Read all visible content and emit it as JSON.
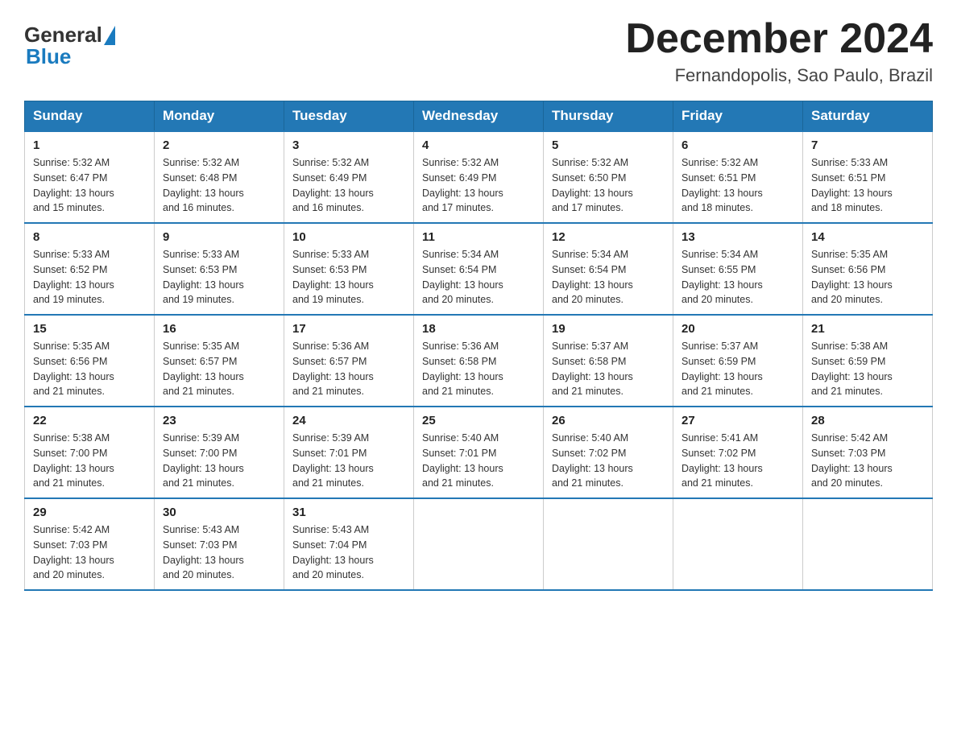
{
  "logo": {
    "general": "General",
    "blue": "Blue"
  },
  "title": "December 2024",
  "location": "Fernandopolis, Sao Paulo, Brazil",
  "days_of_week": [
    "Sunday",
    "Monday",
    "Tuesday",
    "Wednesday",
    "Thursday",
    "Friday",
    "Saturday"
  ],
  "weeks": [
    [
      {
        "day": "1",
        "sunrise": "5:32 AM",
        "sunset": "6:47 PM",
        "daylight": "13 hours and 15 minutes."
      },
      {
        "day": "2",
        "sunrise": "5:32 AM",
        "sunset": "6:48 PM",
        "daylight": "13 hours and 16 minutes."
      },
      {
        "day": "3",
        "sunrise": "5:32 AM",
        "sunset": "6:49 PM",
        "daylight": "13 hours and 16 minutes."
      },
      {
        "day": "4",
        "sunrise": "5:32 AM",
        "sunset": "6:49 PM",
        "daylight": "13 hours and 17 minutes."
      },
      {
        "day": "5",
        "sunrise": "5:32 AM",
        "sunset": "6:50 PM",
        "daylight": "13 hours and 17 minutes."
      },
      {
        "day": "6",
        "sunrise": "5:32 AM",
        "sunset": "6:51 PM",
        "daylight": "13 hours and 18 minutes."
      },
      {
        "day": "7",
        "sunrise": "5:33 AM",
        "sunset": "6:51 PM",
        "daylight": "13 hours and 18 minutes."
      }
    ],
    [
      {
        "day": "8",
        "sunrise": "5:33 AM",
        "sunset": "6:52 PM",
        "daylight": "13 hours and 19 minutes."
      },
      {
        "day": "9",
        "sunrise": "5:33 AM",
        "sunset": "6:53 PM",
        "daylight": "13 hours and 19 minutes."
      },
      {
        "day": "10",
        "sunrise": "5:33 AM",
        "sunset": "6:53 PM",
        "daylight": "13 hours and 19 minutes."
      },
      {
        "day": "11",
        "sunrise": "5:34 AM",
        "sunset": "6:54 PM",
        "daylight": "13 hours and 20 minutes."
      },
      {
        "day": "12",
        "sunrise": "5:34 AM",
        "sunset": "6:54 PM",
        "daylight": "13 hours and 20 minutes."
      },
      {
        "day": "13",
        "sunrise": "5:34 AM",
        "sunset": "6:55 PM",
        "daylight": "13 hours and 20 minutes."
      },
      {
        "day": "14",
        "sunrise": "5:35 AM",
        "sunset": "6:56 PM",
        "daylight": "13 hours and 20 minutes."
      }
    ],
    [
      {
        "day": "15",
        "sunrise": "5:35 AM",
        "sunset": "6:56 PM",
        "daylight": "13 hours and 21 minutes."
      },
      {
        "day": "16",
        "sunrise": "5:35 AM",
        "sunset": "6:57 PM",
        "daylight": "13 hours and 21 minutes."
      },
      {
        "day": "17",
        "sunrise": "5:36 AM",
        "sunset": "6:57 PM",
        "daylight": "13 hours and 21 minutes."
      },
      {
        "day": "18",
        "sunrise": "5:36 AM",
        "sunset": "6:58 PM",
        "daylight": "13 hours and 21 minutes."
      },
      {
        "day": "19",
        "sunrise": "5:37 AM",
        "sunset": "6:58 PM",
        "daylight": "13 hours and 21 minutes."
      },
      {
        "day": "20",
        "sunrise": "5:37 AM",
        "sunset": "6:59 PM",
        "daylight": "13 hours and 21 minutes."
      },
      {
        "day": "21",
        "sunrise": "5:38 AM",
        "sunset": "6:59 PM",
        "daylight": "13 hours and 21 minutes."
      }
    ],
    [
      {
        "day": "22",
        "sunrise": "5:38 AM",
        "sunset": "7:00 PM",
        "daylight": "13 hours and 21 minutes."
      },
      {
        "day": "23",
        "sunrise": "5:39 AM",
        "sunset": "7:00 PM",
        "daylight": "13 hours and 21 minutes."
      },
      {
        "day": "24",
        "sunrise": "5:39 AM",
        "sunset": "7:01 PM",
        "daylight": "13 hours and 21 minutes."
      },
      {
        "day": "25",
        "sunrise": "5:40 AM",
        "sunset": "7:01 PM",
        "daylight": "13 hours and 21 minutes."
      },
      {
        "day": "26",
        "sunrise": "5:40 AM",
        "sunset": "7:02 PM",
        "daylight": "13 hours and 21 minutes."
      },
      {
        "day": "27",
        "sunrise": "5:41 AM",
        "sunset": "7:02 PM",
        "daylight": "13 hours and 21 minutes."
      },
      {
        "day": "28",
        "sunrise": "5:42 AM",
        "sunset": "7:03 PM",
        "daylight": "13 hours and 20 minutes."
      }
    ],
    [
      {
        "day": "29",
        "sunrise": "5:42 AM",
        "sunset": "7:03 PM",
        "daylight": "13 hours and 20 minutes."
      },
      {
        "day": "30",
        "sunrise": "5:43 AM",
        "sunset": "7:03 PM",
        "daylight": "13 hours and 20 minutes."
      },
      {
        "day": "31",
        "sunrise": "5:43 AM",
        "sunset": "7:04 PM",
        "daylight": "13 hours and 20 minutes."
      },
      null,
      null,
      null,
      null
    ]
  ],
  "labels": {
    "sunrise": "Sunrise:",
    "sunset": "Sunset:",
    "daylight": "Daylight:"
  }
}
